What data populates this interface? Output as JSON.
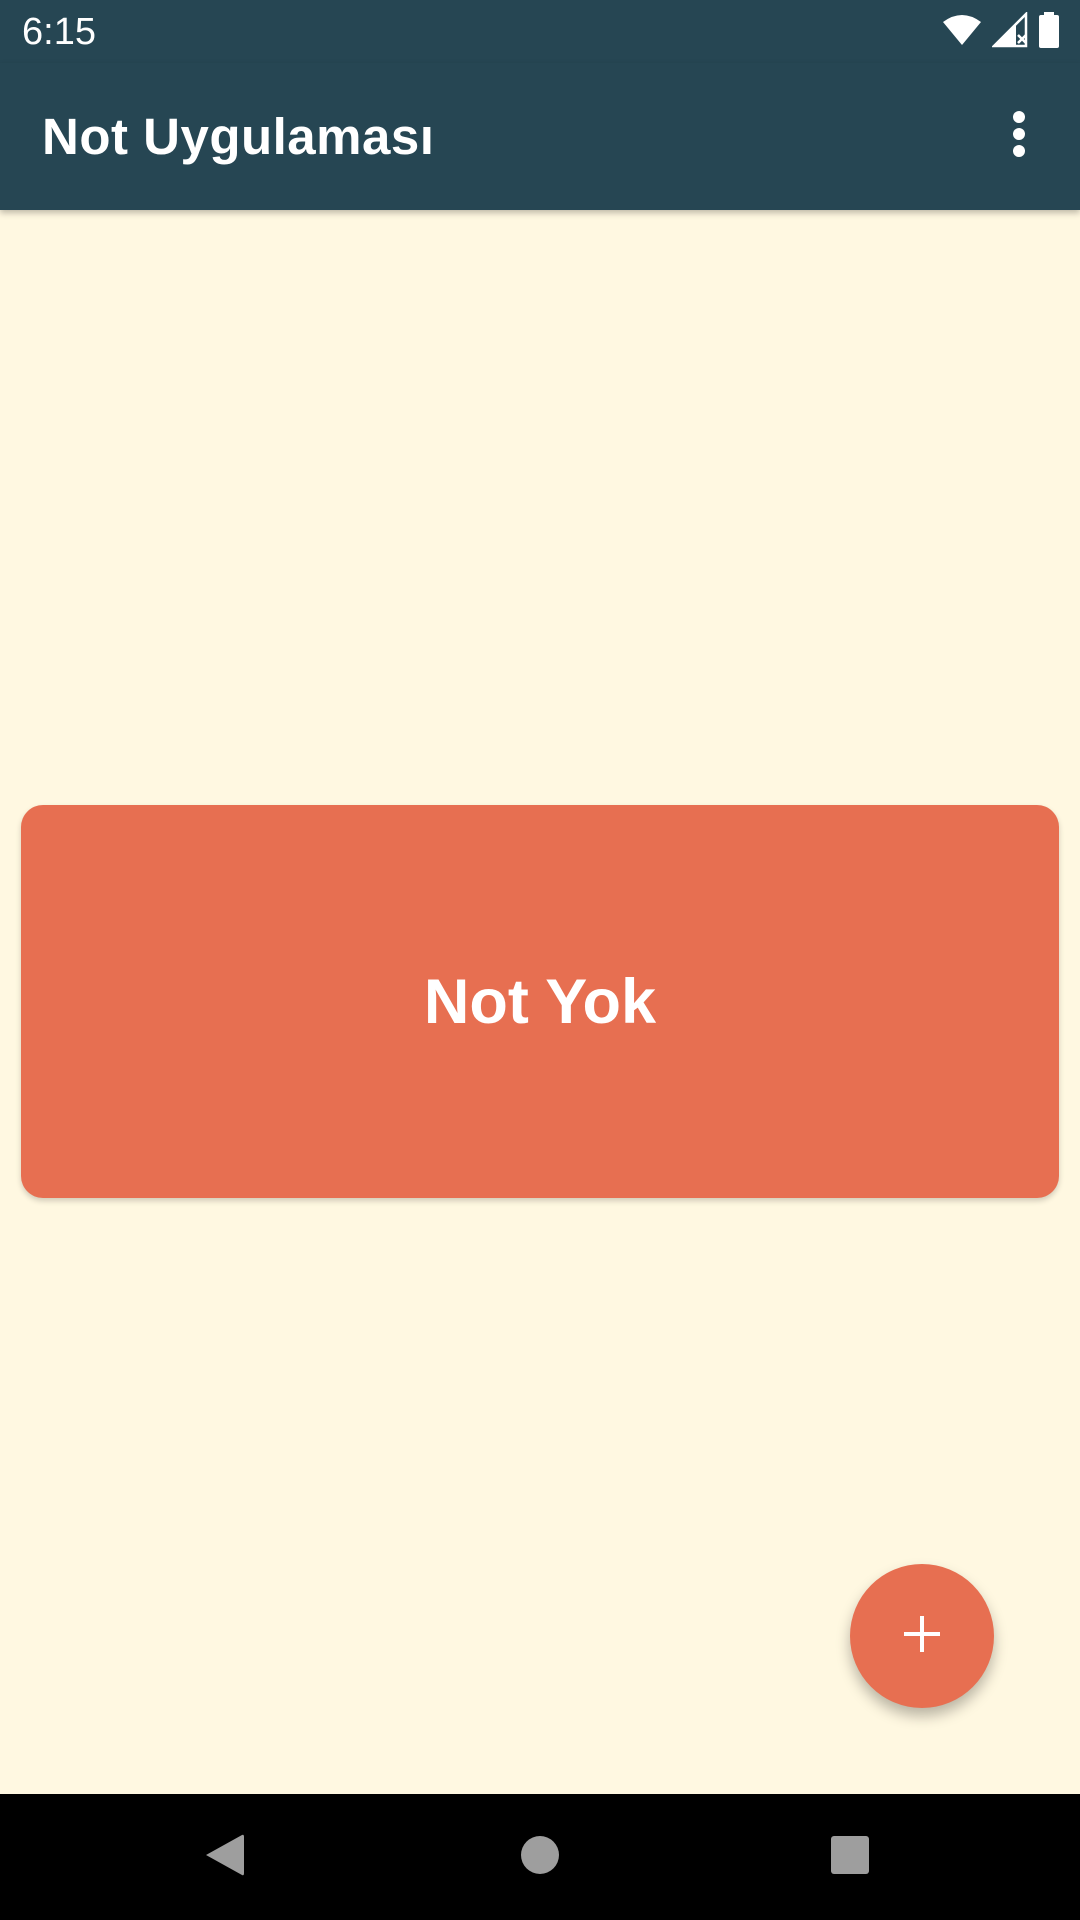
{
  "status_bar": {
    "time": "6:15",
    "icons": [
      "wifi-icon",
      "signal-icon",
      "battery-icon"
    ]
  },
  "app_bar": {
    "title": "Not Uygulaması",
    "overflow_icon": "more-vert-icon"
  },
  "main": {
    "empty_state_text": "Not Yok"
  },
  "fab": {
    "icon": "add-icon"
  },
  "nav_bar": {
    "icons": [
      "back-icon",
      "home-icon",
      "recents-icon"
    ]
  },
  "colors": {
    "primary": "#264653",
    "accent": "#E76F51",
    "background": "#FFF8E1",
    "nav_icon": "#9E9E9E"
  }
}
